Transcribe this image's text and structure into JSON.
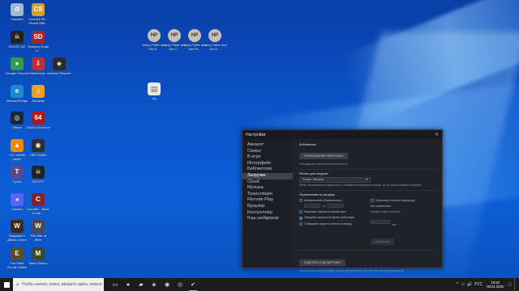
{
  "desktop_icons_left": [
    {
      "name": "recycle-bin",
      "label": "Корзина",
      "color": "#9fb8d8",
      "glyph": "♻"
    },
    {
      "name": "counter-strike",
      "label": "Counter-Str... Global Offe...",
      "color": "#d8a020",
      "glyph": "CS"
    },
    {
      "name": "racist-ac",
      "label": "RACIST AC",
      "color": "#222222",
      "glyph": "☠"
    },
    {
      "name": "sleeping-dogs",
      "label": "Sleeping Dogs D...",
      "color": "#a02828",
      "glyph": "SD"
    },
    {
      "name": "google-chrome",
      "label": "Google Chrome",
      "color": "#2e9e4a",
      "glyph": "●"
    },
    {
      "name": "switchdown",
      "label": "SwitchDow...",
      "color": "#c03030",
      "glyph": "⇩"
    },
    {
      "name": "davinci-resolve",
      "label": "DaVinci Resolve",
      "color": "#2a2a2a",
      "glyph": "◈"
    },
    {
      "name": "microsoft-edge",
      "label": "Microsoft Edge",
      "color": "#1a8ad4",
      "glyph": "e"
    },
    {
      "name": "audacity",
      "label": "Audacity",
      "color": "#f0a020",
      "glyph": "♫"
    },
    {
      "name": "steam",
      "label": "Steam",
      "color": "#1b2838",
      "glyph": "◎"
    },
    {
      "name": "aida64",
      "label": "AIDA64 Extreme",
      "color": "#b01818",
      "glyph": "64"
    },
    {
      "name": "vlc",
      "label": "VLC media player",
      "color": "#f28a00",
      "glyph": "▲"
    },
    {
      "name": "obs-studio",
      "label": "OBS Studio",
      "color": "#302e31",
      "glyph": "◉"
    },
    {
      "name": "tycoo",
      "label": "Tycoo",
      "color": "#5a4a8a",
      "glyph": "T"
    },
    {
      "name": "racist-2",
      "label": "RACIST",
      "color": "#222222",
      "glyph": "☠"
    },
    {
      "name": "discord",
      "label": "Discord",
      "color": "#5865f2",
      "glyph": "◕"
    },
    {
      "name": "counter-back",
      "label": "Counter... Back to the...",
      "color": "#8a2020",
      "glyph": "C"
    },
    {
      "name": "hogwarts",
      "label": "Ведьмак 3 Дикая Охота",
      "color": "#3a2a1a",
      "glyph": "W"
    },
    {
      "name": "the-war-of-mine",
      "label": "This War of Mine",
      "color": "#4a4a4a",
      "glyph": "W"
    },
    {
      "name": "elder-scrolls",
      "label": "The Elder Scrolls Online",
      "color": "#5a4a2a",
      "glyph": "E"
    },
    {
      "name": "metro-redux",
      "label": "Metro Redux",
      "color": "#3a4a2a",
      "glyph": "M"
    }
  ],
  "desktop_icons_top": [
    {
      "name": "harry-potter-1",
      "label": "Harry Potter and the D...",
      "color": "#c8c0b8",
      "glyph": "HP"
    },
    {
      "name": "harry-potter-2",
      "label": "Harry Potter and the C...",
      "color": "#c8c0b8",
      "glyph": "HP"
    },
    {
      "name": "harry-potter-3",
      "label": "Harry Potter and the Ph...",
      "color": "#c8c0b8",
      "glyph": "HP"
    },
    {
      "name": "harry-potter-4",
      "label": "Harry Potter and the G...",
      "color": "#c8c0b8",
      "glyph": "HP"
    }
  ],
  "desktop_file": {
    "label": "cfg",
    "glyph": "📄"
  },
  "steam": {
    "title": "Настройки",
    "nav": [
      "Аккаунт",
      "Семья",
      "В игре",
      "Интерфейс",
      "Библиотека",
      "Загрузки",
      "Cloud",
      "Музыка",
      "Трансляция",
      "Remote Play",
      "Браузер",
      "Контроллер",
      "Кэш шейдеров"
    ],
    "active_index": 5,
    "libraries": {
      "heading": "Библиотеки",
      "button": "ПАПКИ БИБЛИОТЕКИ STEAM",
      "note": "Распределите места хранения контента"
    },
    "region": {
      "heading": "Регион для загрузки",
      "value": "Russia - Moscow",
      "note": "Steam автоматически подключится к ближайшим серверам загрузки, но это можно изменить вручную."
    },
    "limits": {
      "heading": "Ограничения на загрузку",
      "left": [
        {
          "label": "Автоматически обновлять игры",
          "checked": false
        },
        {
          "label": "Разрешить загрузки во время игры",
          "checked": false
        },
        {
          "label": "Замедлять загрузки во время трансляции",
          "checked": true
        },
        {
          "label": "Отображать скорость в битах в секунду",
          "checked": false
        }
      ],
      "time_sep": "до",
      "right_checkbox": {
        "label": "Ограничить скорость загрузки до",
        "checked": false
      },
      "right_value": "Без ограничения",
      "right_hint": "Введите новое значение:",
      "unit": "КБ/с",
      "apply_button": "ПРИМЕНИТЬ"
    },
    "cache": {
      "button": "ОЧИСТИТЬ КЭШ ЗАГРУЗКИ",
      "note": "Очистка кэша загрузки может решить проблемы при загрузке или запуске приложений"
    }
  },
  "taskbar": {
    "search_placeholder": "Чтобы начать поиск, введите здесь запрос",
    "pinned": [
      {
        "name": "task-view-icon",
        "glyph": "▭"
      },
      {
        "name": "chrome-taskbar-icon",
        "glyph": "●"
      },
      {
        "name": "explorer-taskbar-icon",
        "glyph": "▰"
      },
      {
        "name": "davinci-taskbar-icon",
        "glyph": "◈"
      },
      {
        "name": "obs-taskbar-icon",
        "glyph": "◉"
      },
      {
        "name": "steam-taskbar-icon",
        "glyph": "◎"
      },
      {
        "name": "settings-taskbar-icon",
        "glyph": "✔"
      }
    ],
    "active_index": 6,
    "tray_glyphs": [
      "^",
      "▭",
      "🔊",
      "РУС"
    ],
    "time": "19:20",
    "date": "08.01.2022"
  }
}
